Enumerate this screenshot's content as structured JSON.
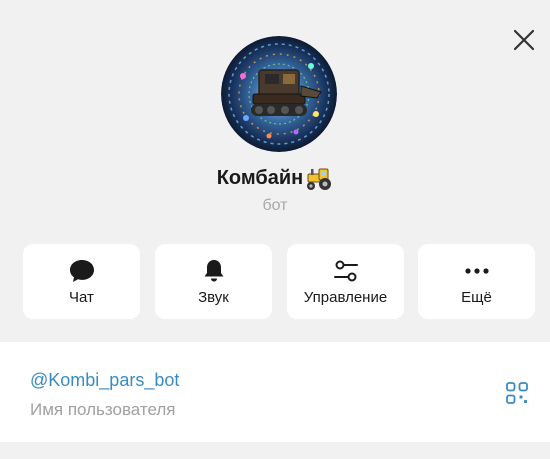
{
  "profile": {
    "name": "Комбайн",
    "subtitle": "бот"
  },
  "actions": [
    {
      "label": "Чат",
      "icon": "chat-bubble-icon"
    },
    {
      "label": "Звук",
      "icon": "bell-icon"
    },
    {
      "label": "Управление",
      "icon": "sliders-icon"
    },
    {
      "label": "Ещё",
      "icon": "more-dots-icon"
    }
  ],
  "info": {
    "username": "@Kombi_pars_bot",
    "username_caption": "Имя пользователя"
  },
  "colors": {
    "background": "#f1f1f1",
    "card": "#ffffff",
    "accent": "#3a8bc4",
    "muted_text": "#a0a0a0",
    "emoji_tractor": "#f2c230"
  }
}
